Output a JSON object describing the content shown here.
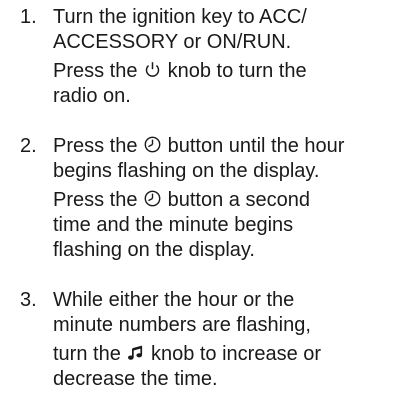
{
  "steps": [
    {
      "number": "1.",
      "lines": [
        {
          "text": "Turn the ignition key to ACC/"
        },
        {
          "text": "ACCESSORY or ON/RUN."
        },
        {
          "before": "Press the ",
          "icon": "power-icon",
          "after": " knob to turn the"
        },
        {
          "text": "radio on."
        }
      ]
    },
    {
      "number": "2.",
      "lines": [
        {
          "before": "Press the ",
          "icon": "clock-icon",
          "after": " button until the hour"
        },
        {
          "text": "begins flashing on the display."
        },
        {
          "before": "Press the ",
          "icon": "clock-icon",
          "after": " button a second"
        },
        {
          "text": "time and the minute begins"
        },
        {
          "text": "flashing on the display."
        }
      ]
    },
    {
      "number": "3.",
      "lines": [
        {
          "text": "While either the hour or the"
        },
        {
          "text": "minute numbers are flashing,"
        },
        {
          "before": "turn the ",
          "icon": "music-note-icon",
          "after": " knob to increase or"
        },
        {
          "text": "decrease the time."
        }
      ]
    }
  ]
}
